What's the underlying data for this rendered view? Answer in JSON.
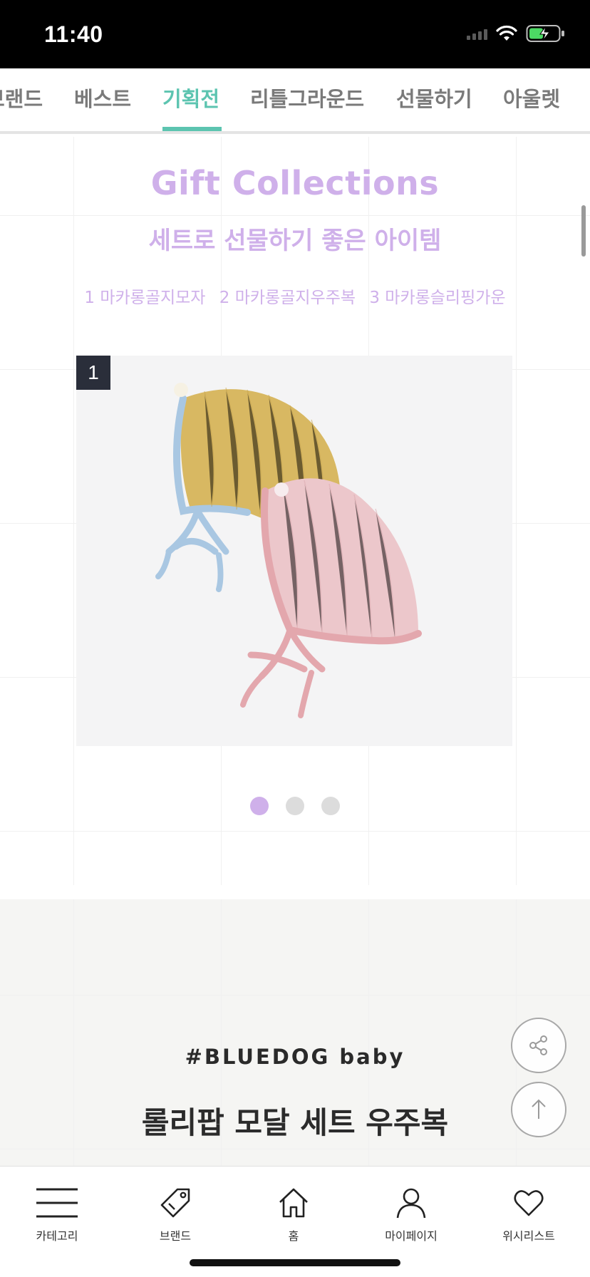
{
  "status_bar": {
    "time": "11:40"
  },
  "tabs": [
    {
      "label": "브랜드"
    },
    {
      "label": "베스트"
    },
    {
      "label": "기획전"
    },
    {
      "label": "리틀그라운드"
    },
    {
      "label": "선물하기"
    },
    {
      "label": "아울렛"
    }
  ],
  "active_tab": "기획전",
  "gift": {
    "title": "Gift Collections",
    "subtitle": "세트로 선물하기 좋은 아이템",
    "items": [
      "1 마카롱골지모자",
      "2 마카롱골지우주복",
      "3 마카롱슬리핑가운"
    ],
    "slide_index": "1",
    "slide_count": 3,
    "active_slide": 1
  },
  "feature": {
    "hashtag": "#BLUEDOG baby",
    "title": "롤리팝 모달 세트 우주복"
  },
  "bottom_nav": [
    {
      "label": "카테고리",
      "icon": "menu-icon"
    },
    {
      "label": "브랜드",
      "icon": "tag-icon"
    },
    {
      "label": "홈",
      "icon": "home-icon"
    },
    {
      "label": "마이페이지",
      "icon": "person-icon"
    },
    {
      "label": "위시리스트",
      "icon": "heart-icon"
    }
  ],
  "colors": {
    "accent_teal": "#5cc4b0",
    "accent_lavender": "#cfb0ea"
  }
}
